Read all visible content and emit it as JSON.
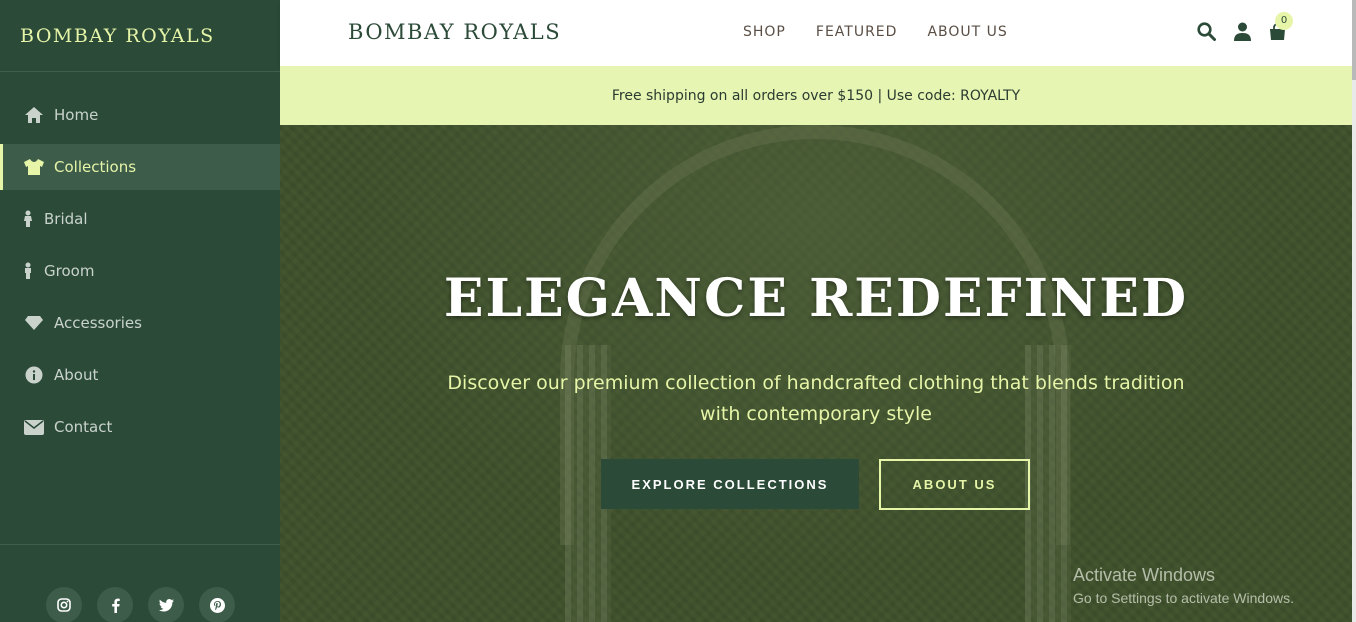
{
  "sidebar": {
    "brand": "BOMBAY ROYALS",
    "items": [
      {
        "label": "Home",
        "icon": "home-icon"
      },
      {
        "label": "Collections",
        "icon": "tshirt-icon",
        "active": true
      },
      {
        "label": "Bridal",
        "icon": "female-icon"
      },
      {
        "label": "Groom",
        "icon": "male-icon"
      },
      {
        "label": "Accessories",
        "icon": "gem-icon"
      },
      {
        "label": "About",
        "icon": "info-icon"
      },
      {
        "label": "Contact",
        "icon": "envelope-icon"
      }
    ],
    "socials": [
      "instagram-icon",
      "facebook-icon",
      "twitter-icon",
      "pinterest-icon"
    ]
  },
  "header": {
    "brand": "BOMBAY ROYALS",
    "menu": [
      "SHOP",
      "FEATURED",
      "ABOUT US"
    ],
    "cart_count": "0"
  },
  "promo": {
    "text": "Free shipping on all orders over $150 | Use code: ROYALTY"
  },
  "hero": {
    "title": "ELEGANCE REDEFINED",
    "subtitle": "Discover our premium collection of handcrafted clothing that blends tradition with contemporary style",
    "primary_button": "EXPLORE COLLECTIONS",
    "secondary_button": "ABOUT US"
  },
  "watermark": {
    "line1": "Activate Windows",
    "line2": "Go to Settings to activate Windows."
  },
  "colors": {
    "sidebar_bg": "#2b4a38",
    "accent": "#e6f5a8",
    "promo_bg": "#e6f5b2"
  }
}
